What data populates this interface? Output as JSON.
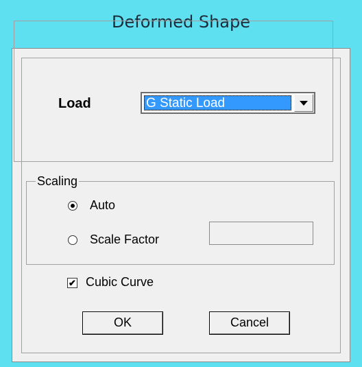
{
  "dialog": {
    "title": "Deformed Shape"
  },
  "load": {
    "label": "Load",
    "selected": "G Static Load"
  },
  "scaling": {
    "legend": "Scaling",
    "options": [
      {
        "label": "Auto",
        "selected": true
      },
      {
        "label": "Scale Factor",
        "selected": false
      }
    ],
    "scale_factor_value": ""
  },
  "cubic_curve": {
    "label": "Cubic Curve",
    "checked": true
  },
  "buttons": {
    "ok": "OK",
    "cancel": "Cancel"
  }
}
